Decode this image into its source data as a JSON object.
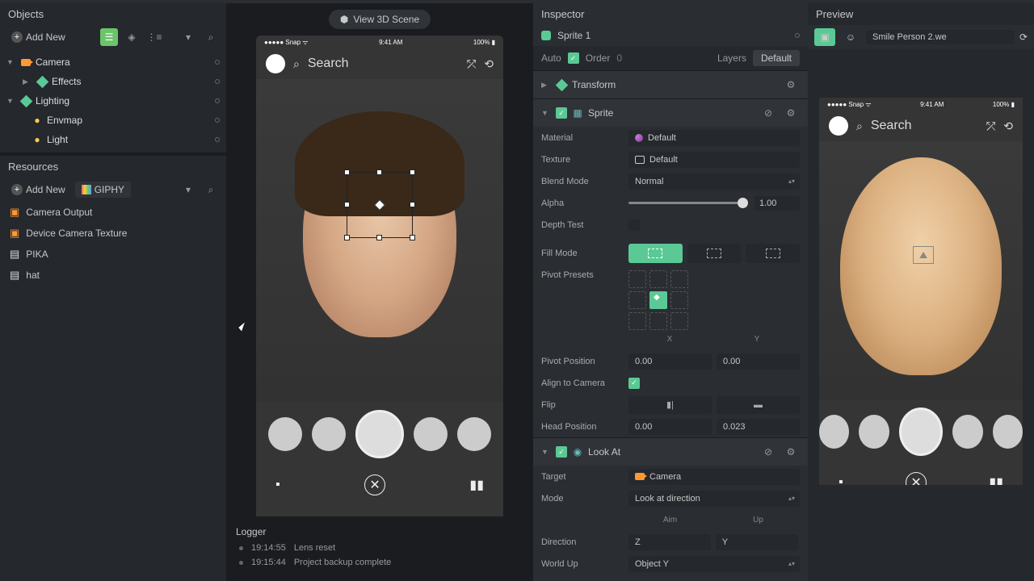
{
  "objects_panel": {
    "title": "Objects",
    "add": "Add New"
  },
  "hierarchy": [
    {
      "label": "Camera",
      "icon": "camera",
      "expanded": true,
      "children": [
        {
          "label": "Effects",
          "icon": "cube"
        }
      ]
    },
    {
      "label": "Lighting",
      "icon": "cube",
      "expanded": true,
      "children": [
        {
          "label": "Envmap",
          "icon": "bulb"
        },
        {
          "label": "Light",
          "icon": "bulb"
        }
      ]
    }
  ],
  "resources": {
    "title": "Resources",
    "add": "Add New",
    "giphy": "GIPHY",
    "items": [
      "Camera Output",
      "Device Camera Texture",
      "PIKA",
      "hat"
    ]
  },
  "view3d": "View 3D Scene",
  "phone": {
    "carrier": "Snap",
    "time": "9:41 AM",
    "battery": "100%",
    "search": "Search"
  },
  "logger": {
    "title": "Logger",
    "rows": [
      {
        "time": "19:14:55",
        "msg": "Lens reset"
      },
      {
        "time": "19:15:44",
        "msg": "Project backup complete"
      }
    ]
  },
  "inspector": {
    "title": "Inspector",
    "object": "Sprite 1",
    "opts": {
      "auto": "Auto",
      "order": "Order",
      "order_v": "0",
      "layers": "Layers",
      "default": "Default"
    },
    "transform": "Transform",
    "sprite": {
      "title": "Sprite",
      "material": "Material",
      "material_v": "Default",
      "texture": "Texture",
      "texture_v": "Default",
      "blend": "Blend Mode",
      "blend_v": "Normal",
      "alpha": "Alpha",
      "alpha_v": "1.00",
      "depth": "Depth Test",
      "fill": "Fill Mode",
      "pivot": "Pivot Presets",
      "pivot_x": "X",
      "pivot_y": "Y",
      "pivot_pos": "Pivot Position",
      "pp_x": "0.00",
      "pp_y": "0.00",
      "align": "Align to Camera",
      "flip": "Flip",
      "head": "Head Position",
      "head_x": "0.00",
      "head_y": "0.023"
    },
    "lookat": {
      "title": "Look At",
      "target": "Target",
      "target_v": "Camera",
      "mode": "Mode",
      "mode_v": "Look at direction",
      "aim": "Aim",
      "up": "Up",
      "direction": "Direction",
      "dir_v": "Z",
      "dir_u": "Y",
      "world": "World Up",
      "world_v": "Object Y"
    }
  },
  "preview": {
    "title": "Preview",
    "device": "Smile Person 2.we"
  }
}
